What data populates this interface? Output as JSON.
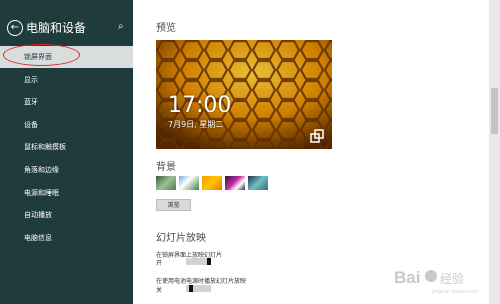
{
  "sidebar": {
    "title": "电脑和设备",
    "items": [
      {
        "label": "锁屏界面"
      },
      {
        "label": "显示"
      },
      {
        "label": "蓝牙"
      },
      {
        "label": "设备"
      },
      {
        "label": "鼠标和触摸板"
      },
      {
        "label": "角落和边缘"
      },
      {
        "label": "电源和睡眠"
      },
      {
        "label": "自动播放"
      },
      {
        "label": "电脑信息"
      }
    ]
  },
  "content": {
    "preview_title": "预览",
    "clock_time": "17:00",
    "clock_date": "7月9日, 星期二",
    "background_title": "背景",
    "browse_label": "浏览",
    "slideshow_title": "幻灯片放映",
    "option1_label": "在锁屏界面上放映幻灯片",
    "option1_state": "开",
    "option1_level": 1,
    "option2_label": "在使用电池电源时播放幻灯片放映",
    "option2_state": "关",
    "option2_level": 0
  },
  "colors": {
    "sidebar_bg": "#1f3b3b",
    "selected_bg": "#d9dddd",
    "annotation": "#d82a2a"
  },
  "watermark": "Bai 经验"
}
